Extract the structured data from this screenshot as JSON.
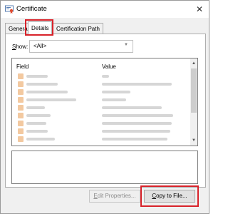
{
  "window": {
    "title": "Certificate",
    "close_glyph": "✕"
  },
  "tabs": [
    {
      "label": "General"
    },
    {
      "label": "Details"
    },
    {
      "label": "Certification Path"
    }
  ],
  "show": {
    "label": "Show:",
    "value": "<All>"
  },
  "list": {
    "columns": {
      "field": "Field",
      "value": "Value"
    },
    "rows_blurred": 9
  },
  "buttons": {
    "edit_properties": "Edit Properties...",
    "copy_to_file": "Copy to File..."
  },
  "colors": {
    "highlight": "#d8222a"
  }
}
